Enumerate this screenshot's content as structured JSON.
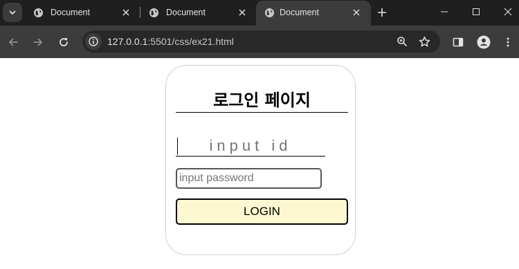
{
  "browser": {
    "tabs": [
      {
        "title": "Document",
        "active": false
      },
      {
        "title": "Document",
        "active": false
      },
      {
        "title": "Document",
        "active": true
      }
    ],
    "url_host": "127.0.0.1",
    "url_rest": ":5501/css/ex21.html"
  },
  "page": {
    "title": "로그인 페이지",
    "id_placeholder": "input id",
    "password_placeholder": "input password",
    "login_label": "LOGIN"
  },
  "colors": {
    "tabstrip_bg": "#1f1f1f",
    "toolbar_bg": "#3c3c3c",
    "login_button_bg": "#fdf8d1"
  }
}
